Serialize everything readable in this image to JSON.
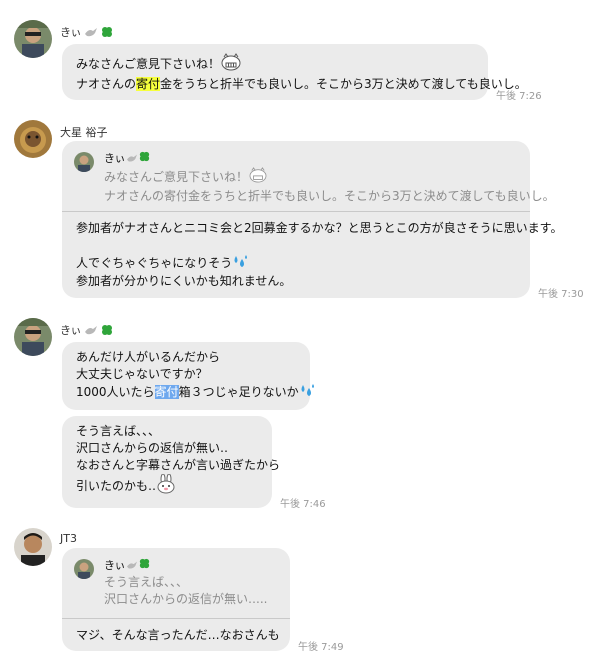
{
  "messages": [
    {
      "sender": "きぃ",
      "lines": [
        "みなさんご意見下さいね！",
        "ナオさんの",
        "寄付",
        "金をうちと折半でも良いし。そこから3万と決めて渡しても良いし。"
      ],
      "time": "午後 7:26"
    },
    {
      "sender": "大星 裕子",
      "quote_sender": "きぃ",
      "quote_lines": [
        "みなさんご意見下さいね！",
        "ナオさんの寄付金をうちと折半でも良いし。そこから3万と決めて渡しても良いし。"
      ],
      "lines": [
        "参加者がナオさんとニコミ会と2回募金するかな？と思うとこの方が良さそうに思います。",
        "人でぐちゃぐちゃになりそう",
        "参加者が分かりにくいかも知れません。"
      ],
      "time": "午後 7:30"
    },
    {
      "sender": "きぃ",
      "lines": [
        "あんだけ人がいるんだから",
        "大丈夫じゃないですか？",
        "1000人いたら",
        "寄付",
        "箱３つじゃ足りないか"
      ],
      "lines2": [
        "そう言えば、、、",
        "沢口さんからの返信が無い‥",
        "なおさんと字幕さんが言い過ぎたから",
        "引いたのかも‥"
      ],
      "time": "午後 7:46"
    },
    {
      "sender": "JT3",
      "quote_sender": "きぃ",
      "quote_lines": [
        "そう言えば、、、",
        "沢口さんからの返信が無い‥..."
      ],
      "lines": [
        "マジ、そんな言ったんだ…なおさんも"
      ],
      "time": "午後 7:49"
    }
  ],
  "colors": {
    "bubble": "#ebebeb",
    "highlight_yellow": "#f6ff3c",
    "highlight_blue": "#6ea8ee",
    "time": "#9a9a9a"
  },
  "icons": [
    "dove-icon",
    "clover-icon",
    "grin-face-icon",
    "sweat-drops-icon",
    "rabbit-face-icon"
  ]
}
